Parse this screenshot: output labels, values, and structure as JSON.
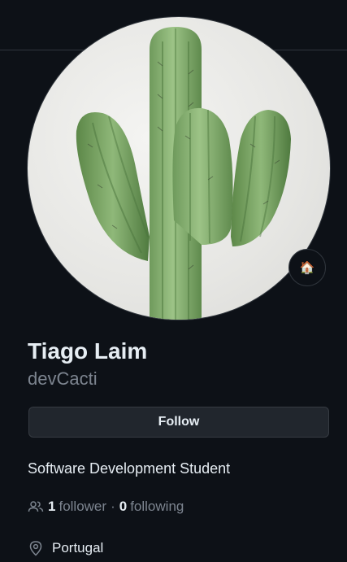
{
  "profile": {
    "name": "Tiago Laim",
    "username": "devCacti",
    "avatar_icon": "cactus-avatar",
    "status_emoji": "🏠",
    "follow_label": "Follow",
    "bio": "Software Development Student",
    "followers": {
      "followers_count": "1",
      "followers_label": "follower",
      "separator": "·",
      "following_count": "0",
      "following_label": "following"
    },
    "location": "Portugal"
  },
  "colors": {
    "background": "#0d1117",
    "text_primary": "#e6edf3",
    "text_muted": "#7d8590",
    "border": "#30363d",
    "button_bg": "#21262d"
  }
}
